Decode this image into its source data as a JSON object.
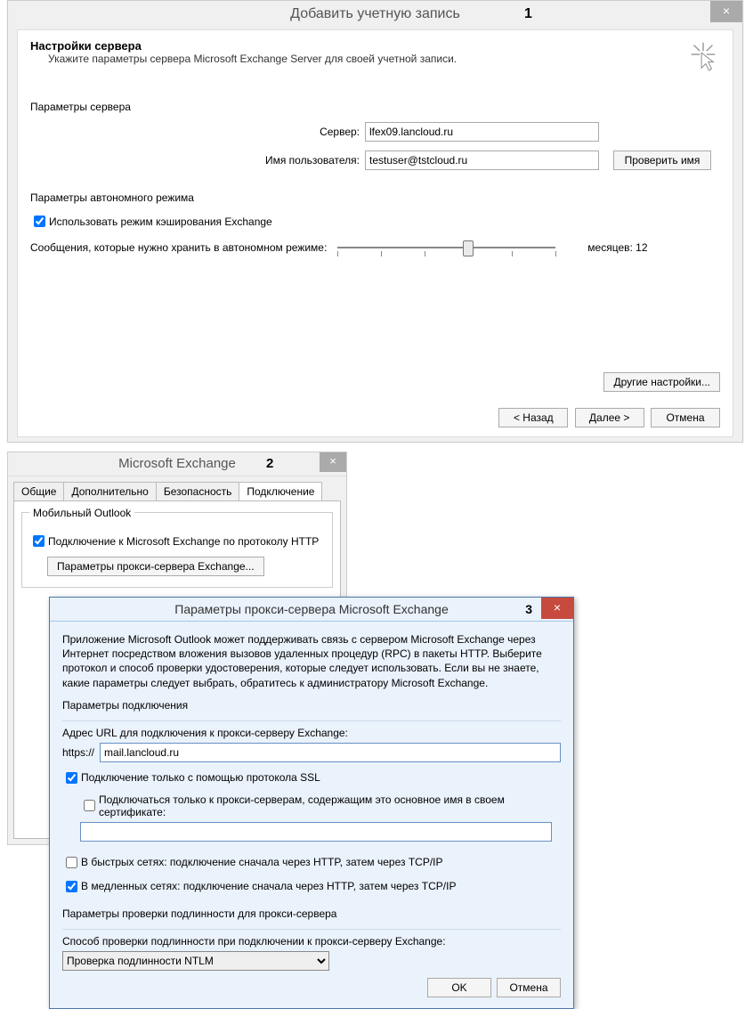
{
  "dlg1": {
    "title": "Добавить учетную запись",
    "num": "1",
    "header": "Настройки сервера",
    "subheader": "Укажите параметры сервера Microsoft Exchange Server для своей учетной записи.",
    "section_server": "Параметры сервера",
    "server_label": "Сервер:",
    "server_value": "lfex09.lancloud.ru",
    "user_label": "Имя пользователя:",
    "user_value": "testuser@tstcloud.ru",
    "check_name": "Проверить имя",
    "section_offline": "Параметры автономного режима",
    "use_cached": "Использовать режим кэширования Exchange",
    "keep_offline_label": "Сообщения, которые нужно хранить в автономном режиме:",
    "months_label": "месяцев: 12",
    "other_settings": "Другие настройки...",
    "back": "< Назад",
    "next": "Далее >",
    "cancel": "Отмена"
  },
  "dlg2": {
    "title": "Microsoft Exchange",
    "num": "2",
    "tabs": {
      "general": "Общие",
      "advanced": "Дополнительно",
      "security": "Безопасность",
      "connection": "Подключение"
    },
    "group_mobile": "Мобильный Outlook",
    "http_check": "Подключение к Microsoft Exchange по протоколу HTTP",
    "proxy_btn": "Параметры прокси-сервера Exchange..."
  },
  "dlg3": {
    "title": "Параметры прокси-сервера Microsoft Exchange",
    "num": "3",
    "intro": "Приложение Microsoft Outlook может поддерживать связь с сервером Microsoft Exchange через Интернет посредством вложения вызовов удаленных процедур (RPC) в пакеты HTTP. Выберите протокол и способ проверки удостоверения, которые следует использовать. Если вы не знаете, какие параметры следует выбрать, обратитесь к администратору Microsoft Exchange.",
    "grp_conn": "Параметры подключения",
    "url_label": "Адрес URL для подключения к прокси-серверу Exchange:",
    "scheme": "https://",
    "url_value": "mail.lancloud.ru",
    "ssl_only": "Подключение только с помощью протокола SSL",
    "cert_check": "Подключаться только к прокси-серверам, содержащим это основное имя в своем сертификате:",
    "fast_net": "В быстрых сетях: подключение сначала через HTTP, затем через TCP/IP",
    "slow_net": "В медленных сетях: подключение сначала через HTTP, затем через TCP/IP",
    "grp_auth": "Параметры проверки подлинности для прокси-сервера",
    "auth_label": "Способ проверки подлинности при подключении к прокси-серверу Exchange:",
    "auth_value": "Проверка подлинности NTLM",
    "ok": "OK",
    "cancel": "Отмена"
  }
}
